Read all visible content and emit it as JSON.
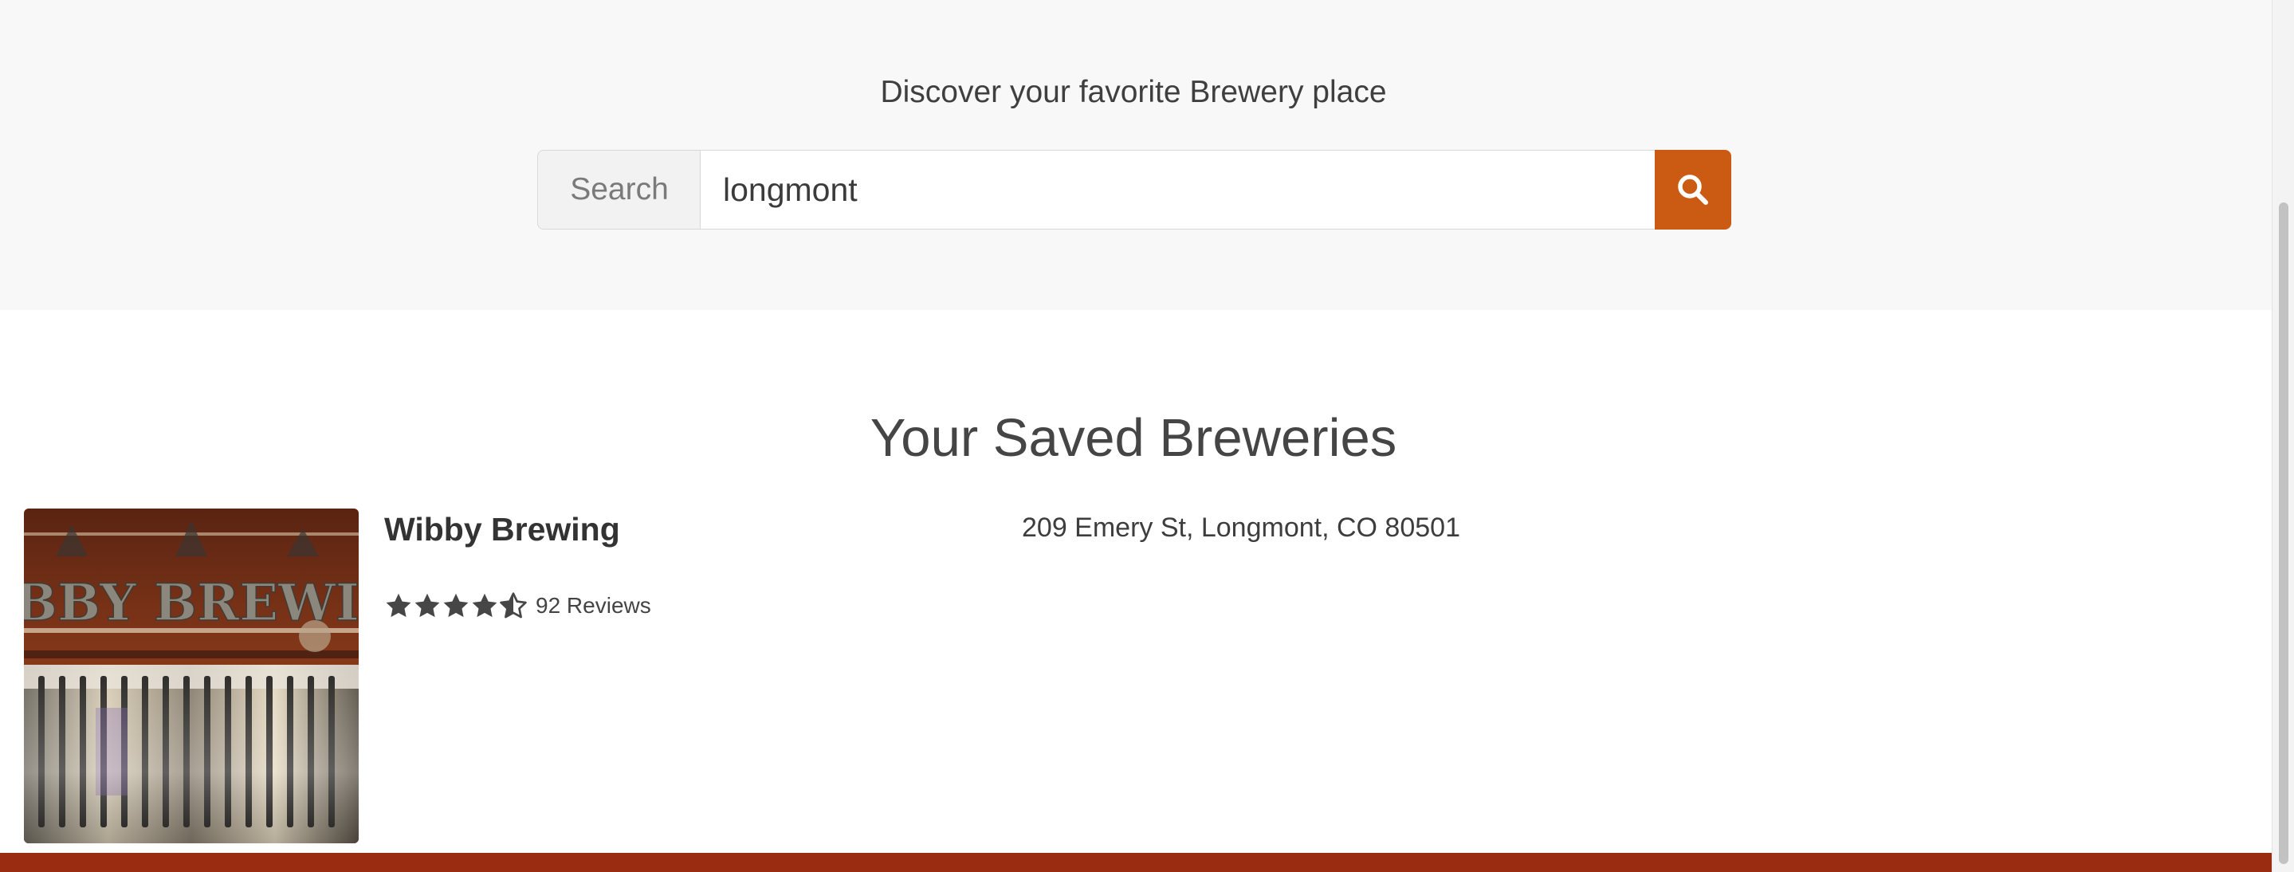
{
  "hero": {
    "title": "Discover your favorite Brewery place"
  },
  "search": {
    "label": "Search",
    "value": "longmont",
    "button_icon": "search-icon"
  },
  "saved": {
    "title": "Your Saved Breweries",
    "items": [
      {
        "name": "Wibby Brewing",
        "address": "209 Emery St, Longmont, CO 80501",
        "rating": 4.5,
        "rating_max": 5,
        "reviews": "92 Reviews",
        "image_sign_text": "WIBBY BREWING"
      }
    ]
  },
  "colors": {
    "accent": "#cb5a12",
    "footer": "#9a2d11",
    "hero_bg": "#f8f8f8",
    "star": "#464646"
  }
}
